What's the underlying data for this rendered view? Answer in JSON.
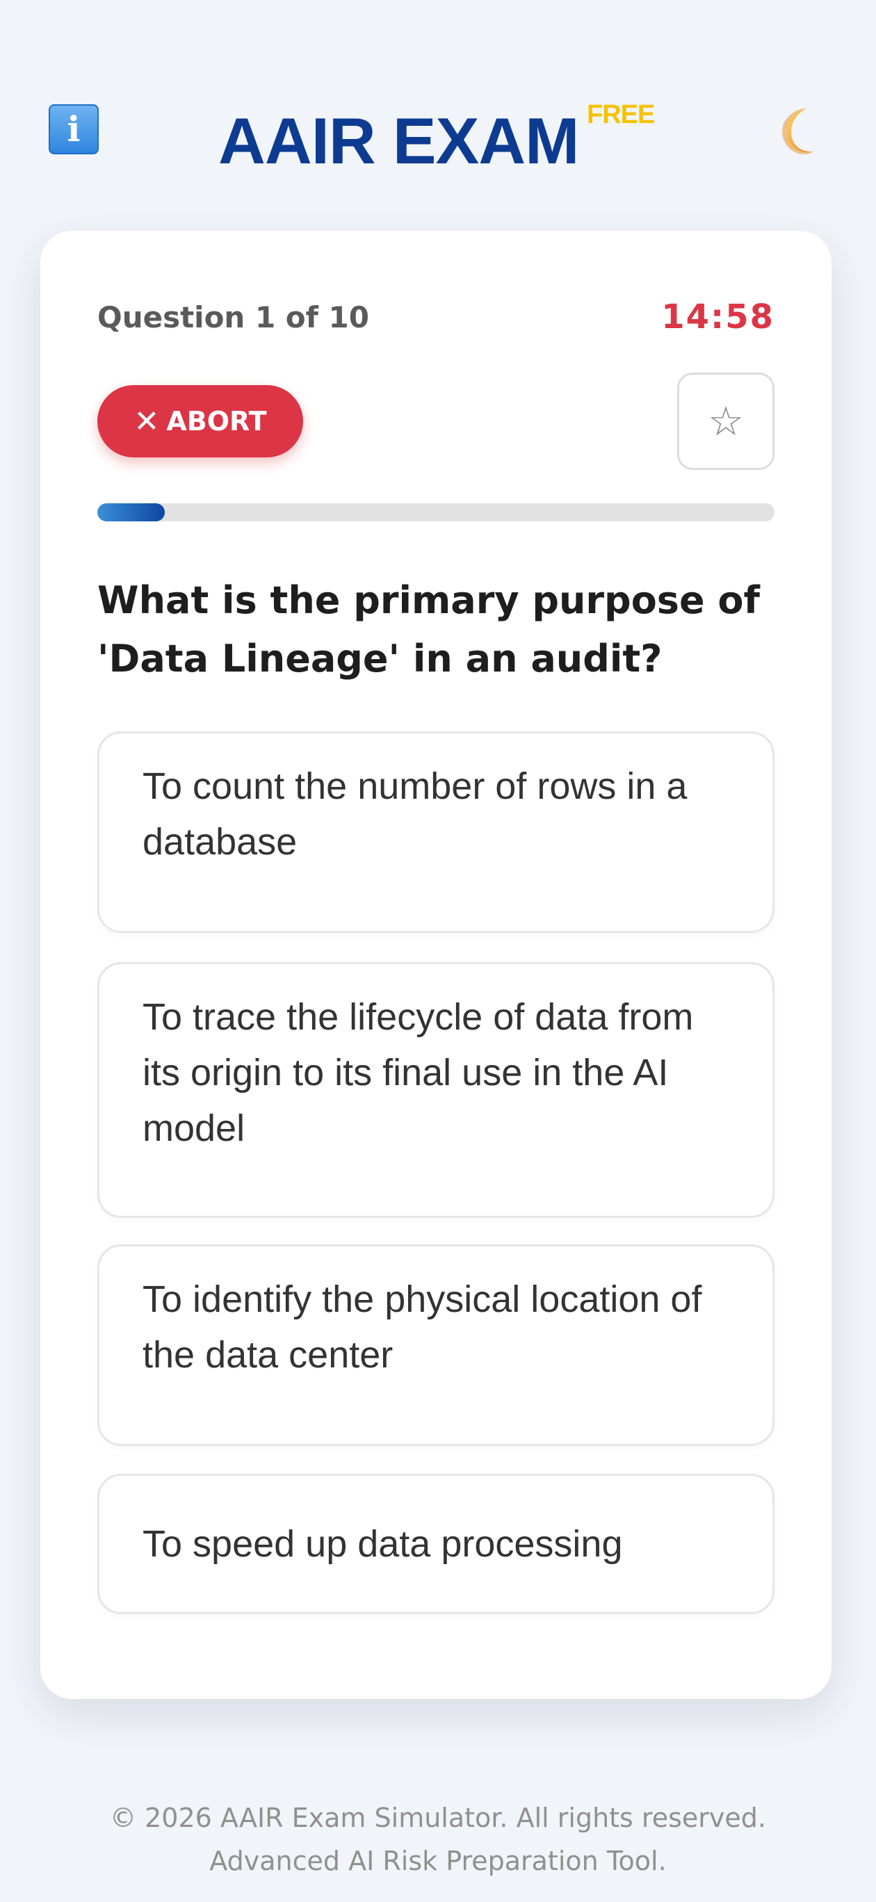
{
  "header": {
    "info_icon": "info-icon",
    "info_label": "i",
    "brand": "AAIR EXAM",
    "badge": "FREE",
    "theme_icon": "crescent-moon-icon"
  },
  "quiz": {
    "counter": "Question 1 of 10",
    "timer": "14:58",
    "abort_label": "ABORT",
    "abort_icon": "close-icon",
    "bookmark_icon": "star-outline-icon",
    "progress_fraction": 0.1,
    "question": "What is the primary purpose of 'Data Lineage' in an audit?",
    "options": [
      "To count the number of rows in a database",
      "To trace the lifecycle of data from its origin to its final use in the AI model",
      "To identify the physical location of the data center",
      "To speed up data processing"
    ]
  },
  "footer": {
    "line1": "© 2026 AAIR Exam Simulator. All rights reserved.",
    "line2": "Advanced AI Risk Preparation Tool."
  },
  "colors": {
    "brand": "#0d3b91",
    "badge": "#f6c200",
    "danger": "#dc3545",
    "progress": "#1565c0"
  }
}
